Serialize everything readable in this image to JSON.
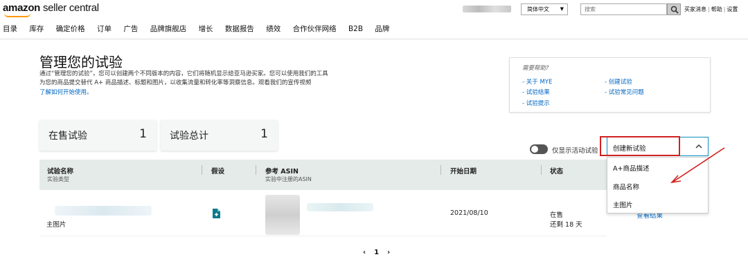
{
  "header": {
    "logo_brand": "amazon",
    "logo_product": "seller central",
    "language": "简体中文",
    "search_placeholder": "搜索",
    "links": [
      "买家消息",
      "帮助",
      "设置"
    ]
  },
  "nav": [
    "目录",
    "库存",
    "确定价格",
    "订单",
    "广告",
    "品牌旗舰店",
    "增长",
    "数据报告",
    "绩效",
    "合作伙伴网络",
    "B2B",
    "品牌"
  ],
  "page": {
    "title": "管理您的试验",
    "intro_line1": "通过“管理您的试验”，您可以创建两个不同版本的内容，它们将随机显示给亚马逊买家。您可以使用我们的工具",
    "intro_line2": "为您的商品提交替代 A+ 商品描述、标题和图片，以收集流量和转化率等洞察信息。观看我们的宣传视频",
    "intro_link": "了解如何开始使用。"
  },
  "help": {
    "heading": "需要帮助?",
    "links": [
      "- 关于 MYE",
      "- 试验结果",
      "- 试验提示",
      "- 创建试验",
      "- 试验常见问题"
    ]
  },
  "stats": [
    {
      "label": "在售试验",
      "value": "1"
    },
    {
      "label": "试验总计",
      "value": "1"
    }
  ],
  "filter": {
    "toggle_label": "仅显示活动试验",
    "create_label": "创建新试验",
    "options": [
      "A+商品描述",
      "商品名称",
      "主图片"
    ]
  },
  "table": {
    "headers": [
      {
        "title": "试验名称",
        "sub": "实验类型"
      },
      {
        "title": "假设",
        "sub": ""
      },
      {
        "title": "参考 ASIN",
        "sub": "实验中注册的ASIN"
      },
      {
        "title": "开始日期",
        "sub": ""
      },
      {
        "title": "状态",
        "sub": ""
      }
    ],
    "row": {
      "type": "主图片",
      "start_date": "2021/08/10",
      "status": "在售",
      "remaining": "还剩 18 天",
      "action": "查看结果"
    }
  },
  "pagination": {
    "prev": "‹",
    "page": "1",
    "next": "›"
  },
  "colors": {
    "link": "#0066c0",
    "highlight": "#d0211f",
    "table_header": "#e4ebe9",
    "accent": "#0a8ec0"
  }
}
